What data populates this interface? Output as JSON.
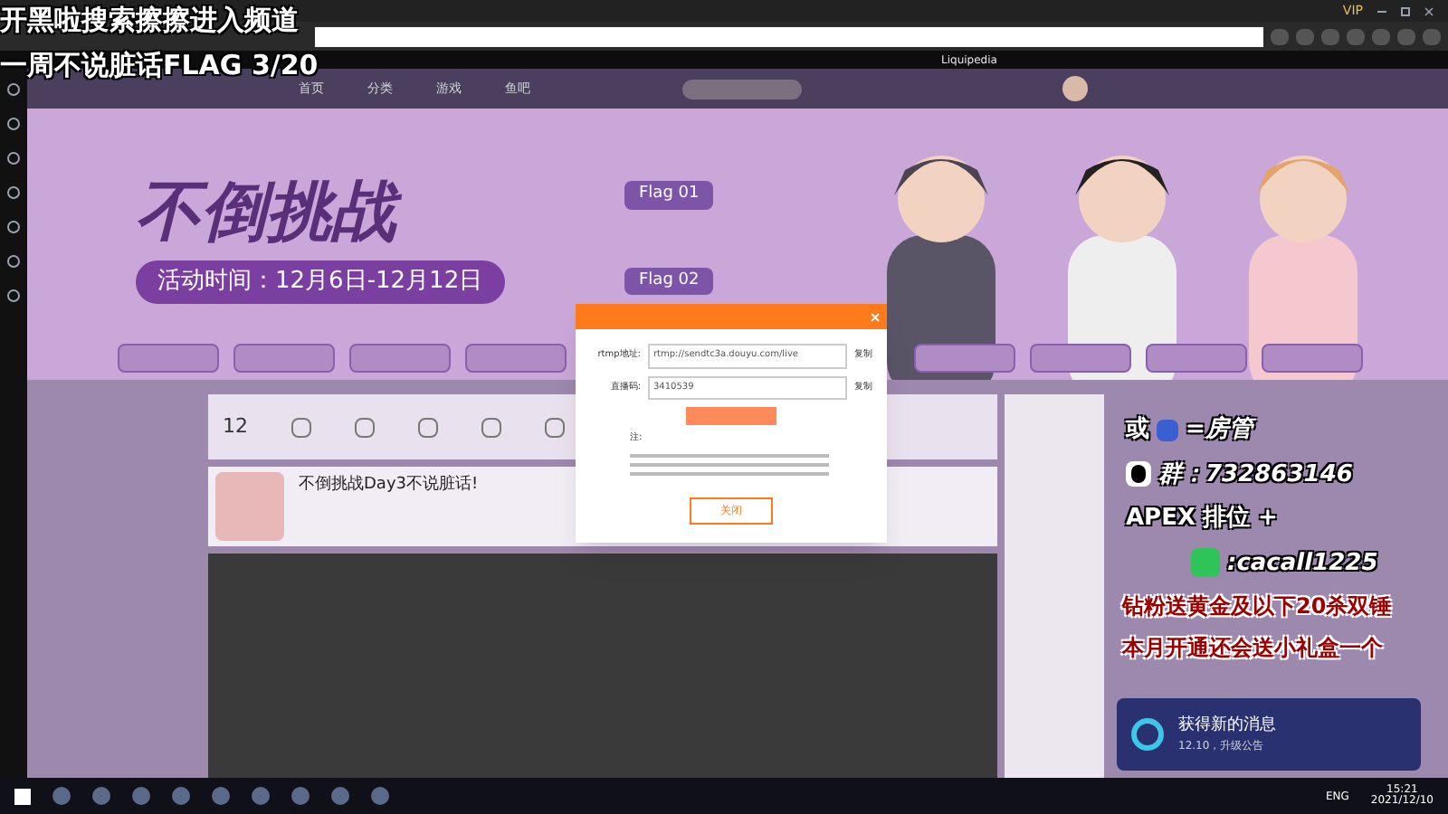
{
  "overlay": {
    "line1": "开黑啦搜索擦擦进入频道",
    "line2": "一周不说脏话FLAG 3/20"
  },
  "browser": {
    "vip": "VIP",
    "bookmarks": [
      {
        "label": "Liquipedia"
      }
    ]
  },
  "nav": [
    {
      "label": "首页",
      "selected": false
    },
    {
      "label": "分类",
      "selected": false
    },
    {
      "label": "游戏",
      "selected": false
    },
    {
      "label": "鱼吧",
      "selected": false
    }
  ],
  "banner": {
    "title": "不倒挑战",
    "dates": "活动时间：12月6日-12月12日",
    "flags": [
      "Flag 01",
      "Flag 02"
    ]
  },
  "dialog": {
    "fields": [
      {
        "label": "rtmp地址:",
        "value": "rtmp://sendtc3a.douyu.com/live",
        "action": "复制"
      },
      {
        "label": "直播码:",
        "value": "3410539",
        "action": "复制"
      }
    ],
    "note": "注:",
    "close": "关闭"
  },
  "stats": {
    "count": "12"
  },
  "stream": {
    "title": "不倒挑战Day3不说脏话!"
  },
  "promo": {
    "or": "或",
    "role": "=房管",
    "qq": "群：732863146",
    "apex": "APEX",
    "rank": "排位 +",
    "wechat": ":cacall1225",
    "line1": "钻粉送黄金及以下20杀双锤",
    "line2": "本月开通还会送小礼盒一个"
  },
  "notification": {
    "title": "获得新的消息",
    "detail": "12.10，升级公告"
  },
  "taskbar": {
    "lang": "ENG",
    "time": "15:21",
    "date": "2021/12/10"
  }
}
